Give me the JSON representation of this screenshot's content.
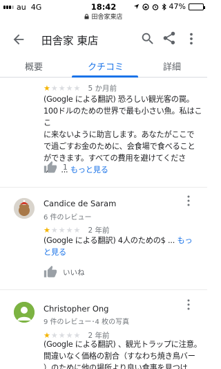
{
  "status_bar": {
    "carrier": "au",
    "network": "4G",
    "time": "18:42",
    "battery": "47%",
    "battery_level": 0.47
  },
  "url_bar": {
    "text": "田舎家東店"
  },
  "header": {
    "title": "田舎家 東店"
  },
  "tabs": [
    {
      "label": "概要",
      "active": false
    },
    {
      "label": "クチコミ",
      "active": true
    },
    {
      "label": "詳細",
      "active": false
    }
  ],
  "reviews": [
    {
      "rating": 1,
      "date": "5 か月前",
      "text_lines": [
        "(Google による翻訳) 恐ろしい観光客の罠。",
        "100ドルのための世界で最も小さい魚。私はここ",
        "に来ないように助言します。あなたがここで",
        "で過ごすお金のために、会食場で食べること",
        "ができます。すべての費用を避けてくださ"
      ],
      "last_line": "い！ ...",
      "more_label": "もっと見る",
      "likes": "1"
    },
    {
      "name": "Candice de Saram",
      "meta": "6 件のレビュー",
      "rating": 1,
      "date": "2 年前",
      "text_lines": [
        "(Google による翻訳) 4人のための$ ..."
      ],
      "more_label": "もっと見る",
      "like_label": "いいね"
    },
    {
      "name": "Christopher Ong",
      "meta": "9 件のレビュー･4 枚の写真",
      "rating": 1,
      "date": "2 年前",
      "text_lines": [
        "(Google による翻訳) 、観光トラップに注意。",
        "間違いなく価格の割合（すなわち焼き鳥バー",
        "）のために他の場所より良い食事を見つけ"
      ]
    }
  ],
  "colors": {
    "accent": "#1a73e8",
    "star_on": "#f4b400",
    "star_off": "#dadce0"
  }
}
